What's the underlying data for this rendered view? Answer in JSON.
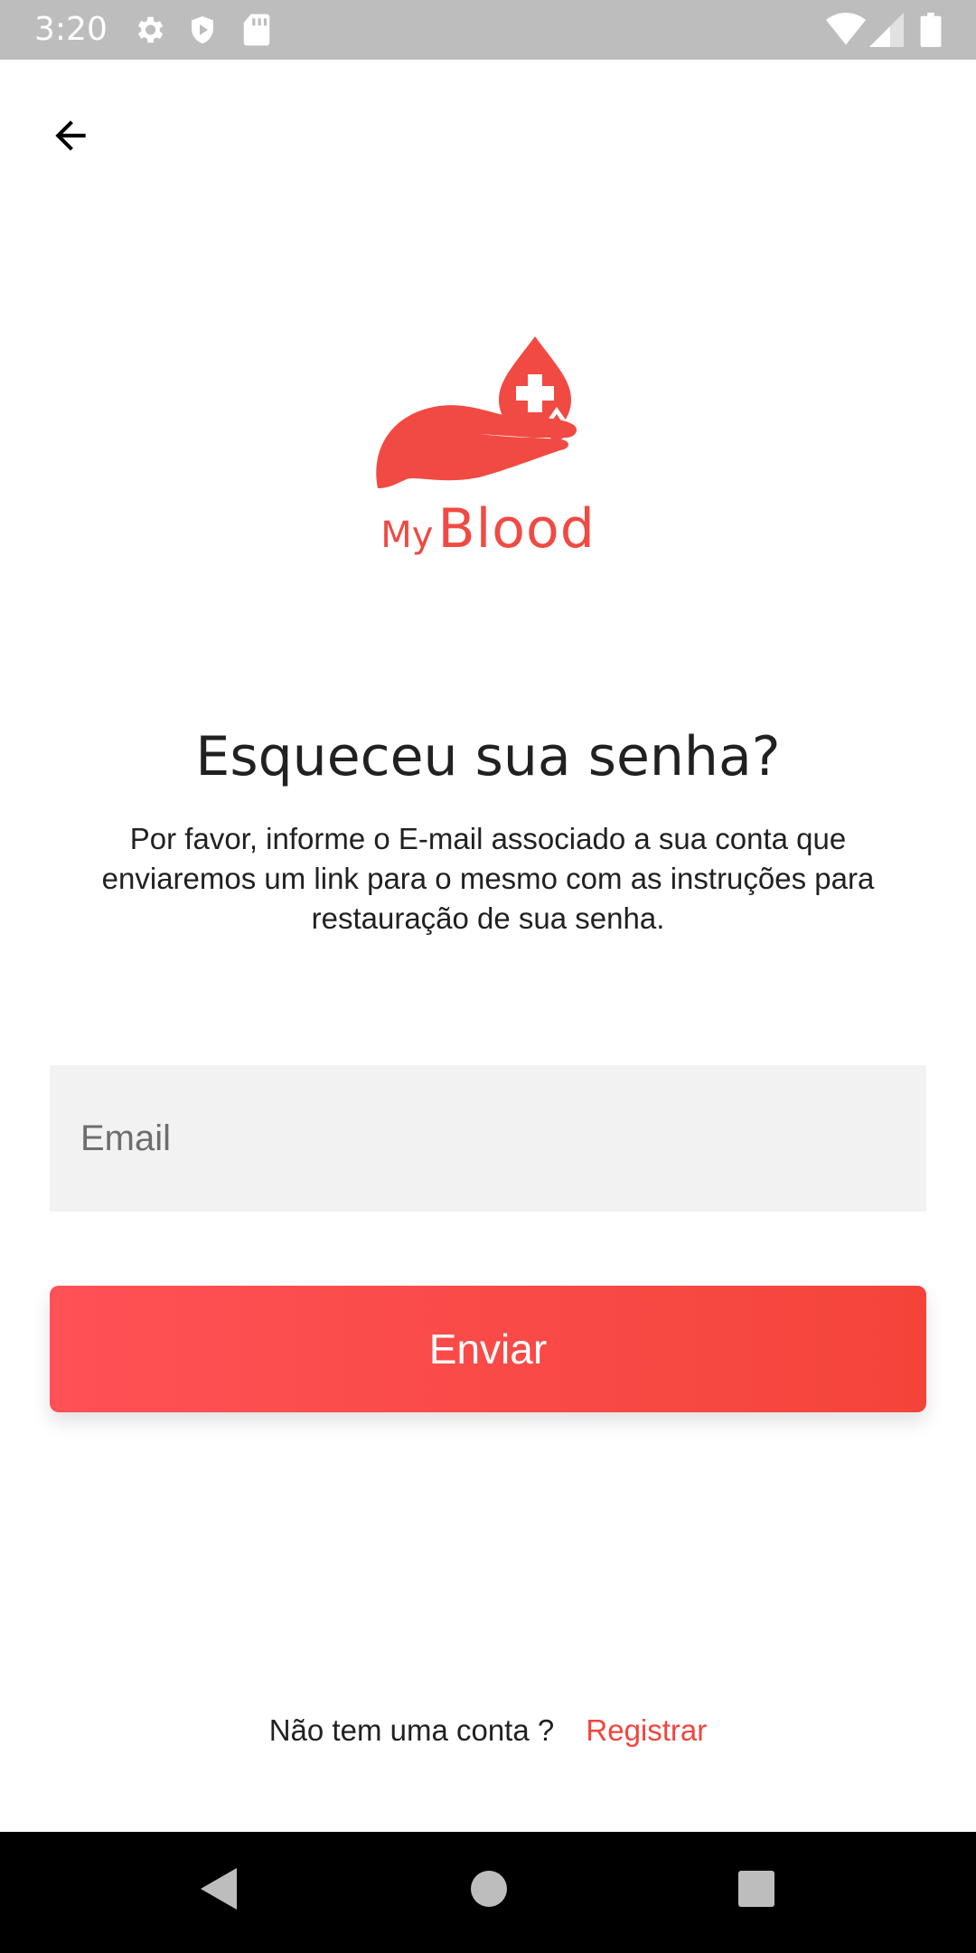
{
  "status_bar": {
    "time": "3:20",
    "icons": [
      "gear-icon",
      "shield-icon",
      "sd-card-icon",
      "wifi-icon",
      "cell-signal-icon",
      "battery-icon"
    ]
  },
  "header": {
    "back_icon": "arrow-back-icon"
  },
  "logo": {
    "text_my": "My",
    "text_blood": "Blood",
    "brand_color": "#f04a43"
  },
  "main": {
    "title": "Esqueceu sua senha?",
    "description": "Por favor, informe o E-mail associado a sua conta que enviaremos um link para o mesmo com as instruções para restauração de sua senha.",
    "email_field": {
      "placeholder": "Email",
      "value": ""
    },
    "submit_label": "Enviar"
  },
  "footer": {
    "prompt": "Não tem uma conta ?",
    "register_link": "Registrar"
  },
  "colors": {
    "accent": "#f4443a",
    "accent_light": "#ff5156",
    "status_bar": "#bdbdbd",
    "nav_bar": "#000000"
  }
}
